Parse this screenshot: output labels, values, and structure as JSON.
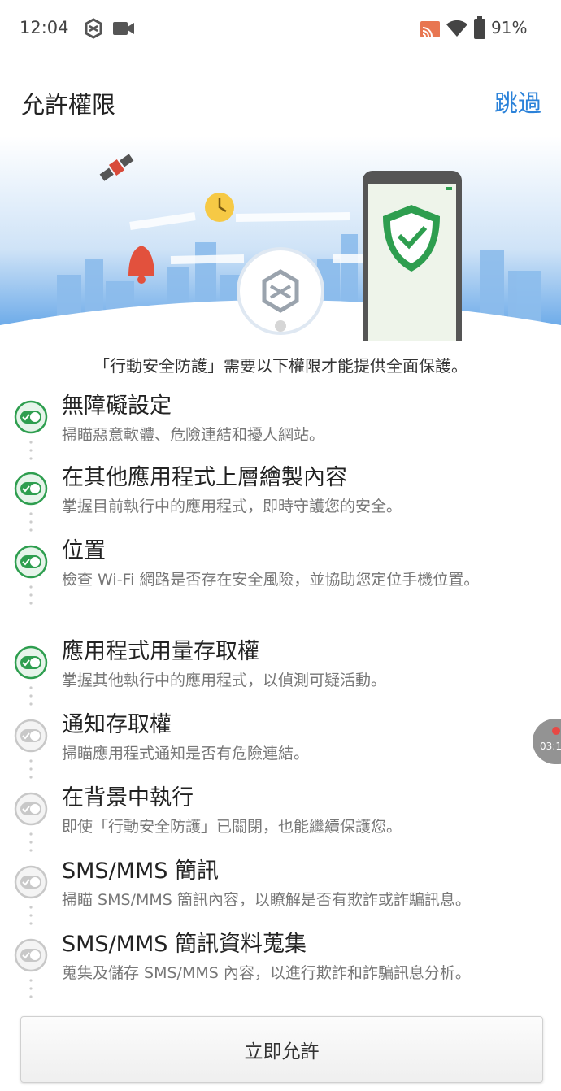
{
  "status_bar": {
    "time": "12:04",
    "battery": "91%",
    "icons": [
      "trend-app-icon",
      "video-icon",
      "cast-icon",
      "wifi-icon",
      "battery-icon"
    ]
  },
  "header": {
    "title": "允許權限",
    "skip_label": "跳過"
  },
  "banner": {
    "icons": [
      "satellite-icon",
      "clock-icon",
      "bell-icon",
      "trend-logo-icon",
      "phone-icon",
      "shield-check-icon"
    ]
  },
  "intro_text": "「行動安全防護」需要以下權限才能提供全面保護。",
  "permissions": [
    {
      "title": "無障礙設定",
      "desc": "掃瞄惡意軟體、危險連結和擾人網站。",
      "enabled": true
    },
    {
      "title": "在其他應用程式上層繪製內容",
      "desc": "掌握目前執行中的應用程式，即時守護您的安全。",
      "enabled": true
    },
    {
      "title": "位置",
      "desc": "檢查 Wi-Fi 網路是否存在安全風險，並協助您定位手機位置。",
      "enabled": true
    },
    {
      "title": "應用程式用量存取權",
      "desc": "掌握其他執行中的應用程式，以偵測可疑活動。",
      "enabled": true
    },
    {
      "title": "通知存取權",
      "desc": "掃瞄應用程式通知是否有危險連結。",
      "enabled": false
    },
    {
      "title": "在背景中執行",
      "desc": "即使「行動安全防護」已關閉，也能繼續保護您。",
      "enabled": false
    },
    {
      "title": "SMS/MMS 簡訊",
      "desc": "掃瞄 SMS/MMS 簡訊內容，以瞭解是否有欺詐或詐騙訊息。",
      "enabled": false
    },
    {
      "title": "SMS/MMS 簡訊資料蒐集",
      "desc": "蒐集及儲存 SMS/MMS 內容，以進行欺詐和詐騙訊息分析。",
      "enabled": false
    }
  ],
  "recorder": {
    "time": "03:1"
  },
  "allow_button": "立即允許",
  "colors": {
    "accent_blue": "#2b82d9",
    "toggle_on": "#2e9e4f",
    "toggle_off": "#c8c8c8"
  }
}
